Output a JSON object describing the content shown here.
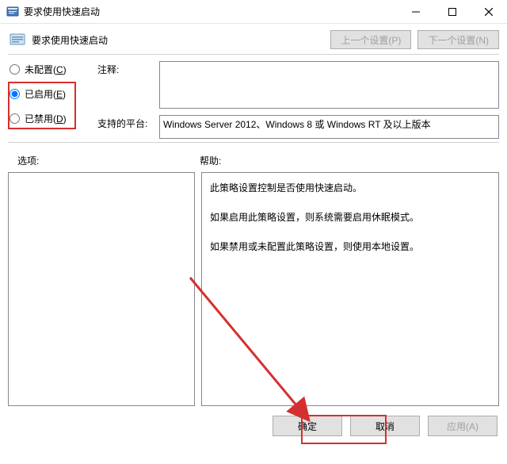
{
  "window": {
    "title": "要求使用快速启动"
  },
  "header": {
    "policy_title": "要求使用快速启动",
    "prev_btn": "上一个设置(P)",
    "next_btn": "下一个设置(N)"
  },
  "radios": {
    "not_configured": {
      "label": "未配置(",
      "hotkey": "C",
      "suffix": ")"
    },
    "enabled": {
      "label": "已启用(",
      "hotkey": "E",
      "suffix": ")"
    },
    "disabled": {
      "label": "已禁用(",
      "hotkey": "D",
      "suffix": ")"
    }
  },
  "fields": {
    "comment_label": "注释:",
    "comment_value": "",
    "platform_label": "支持的平台:",
    "platform_value": "Windows Server 2012、Windows 8 或 Windows RT 及以上版本"
  },
  "mid": {
    "options_label": "选项:",
    "help_label": "帮助:"
  },
  "help": {
    "p1": "此策略设置控制是否使用快速启动。",
    "p2": "如果启用此策略设置，则系统需要启用休眠模式。",
    "p3": "如果禁用或未配置此策略设置，则使用本地设置。"
  },
  "footer": {
    "ok": "确定",
    "cancel": "取消",
    "apply": "应用(A)"
  }
}
